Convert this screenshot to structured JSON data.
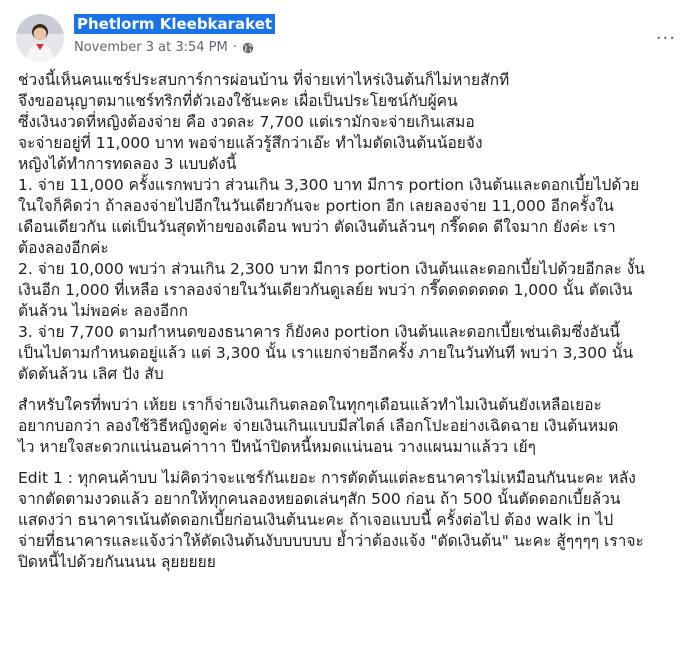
{
  "post": {
    "author": "Phetlorm Kleebkaraket",
    "timestamp": "November 3 at 3:54 PM",
    "separator": "·",
    "privacy_icon": "globe-icon",
    "more_icon": "more-options-icon",
    "more_label": "···"
  },
  "body": {
    "p1": [
      "ช่วงนี้เห็นคนแชร์ประสบการ์การผ่อนบ้าน ที่จ่ายเท่าไหร่เงินต้นก็ไม่หายสักที",
      "จึงขออนุญาตมาแชร์ทริกที่ตัวเองใช้นะคะ เผื่อเป็นประโยชน์กับผู้คน",
      "ซึ่งเงินงวดที่หญิงต้องจ่าย คือ งวดละ 7,700 แต่เรามักจะจ่ายเกินเสมอ",
      "จะจ่ายอยู่ที่ 11,000 บาท พอจ่ายแล้วรู้สึกว่าเอ๊ะ ทำไมตัดเงินต้นน้อยจัง",
      "หญิงได้ทำการทดลอง 3 แบบดังนี้",
      "1. จ่าย 11,000 ครั้งแรกพบว่า ส่วนเกิน 3,300 บาท มีการ portion เงินต้นและดอกเบี้ยไปด้วย",
      "ในใจก็คิดว่า ถ้าลองจ่ายไปอีกในวันเดียวกันจะ portion อีก เลยลองจ่าย 11,000 อีกครั้งใน",
      "เดือนเดียวกัน แต่เป็นวันสุดท้ายของเดือน พบว่า ตัดเงินต้นล้วนๆ กรี๊ดดด ดีใจมาก ยังค่ะ เรา",
      "ต้องลองอีกค่ะ",
      "2. จ่าย 10,000 พบว่า ส่วนเกิน 2,300 บาท มีการ portion เงินต้นและดอกเบี้ยไปด้วยอีกละ งั้น",
      "เงินอีก 1,000 ที่เหลือ เราลองจ่ายในวันเดียวกันดูเลย์ย พบว่า กรี๊ดดดดดดด 1,000 นั้น ตัดเงิน",
      "ต้นล้วน ไม่พอค่ะ ลองอีกก",
      "3. จ่าย 7,700 ตามกำหนดของธนาคาร ก็ยังคง portion เงินต้นและดอกเบี้ยเช่นเดิมซึ่งอันนี้",
      "เป็นไปตามกำหนดอยู่แล้ว แต่ 3,300 นั้น เราแยกจ่ายอีกครั้ง ภายในวันทันที พบว่า 3,300 นั้น",
      "ตัดต้นล้วน เลิศ ปัง สับ"
    ],
    "p2": [
      "สำหรับใครที่พบว่า เห้ยย เราก็จ่ายเงินเกินตลอดในทุกๆเดือนแล้วทำไมเงินต้นยังเหลือเยอะ",
      "อยากบอกว่า ลองใช้วิธีหญิงดูค่ะ จ่ายเงินเกินแบบมีสไตล์ เลือกโปะอย่างเฉิดฉาย เงินต้นหมด",
      "ไว หายใจสะดวกแน่นอนค่าาาา ปีหน้าปิดหนี้หมดแน่นอน วางแผนมาแล้วว เย้ๆ"
    ],
    "p3": [
      "Edit 1 : ทุกคนค้าบบ ไม่คิดว่าจะแชร์กันเยอะ การตัดต้นแต่ละธนาคารไม่เหมือนกันนะคะ หลัง",
      "จากตัดตามงวดแล้ว อยากให้ทุกคนลองหยอดเล่นๆสัก 500 ก่อน ถ้า 500 นั้นตัดดอกเบี้ยล้วน",
      "แสดงว่า ธนาคารเน้นตัดดอกเบี้ยก่อนเงินต้นนะคะ ถ้าเจอแบบนี้ ครั้งต่อไป ต้อง walk in ไป",
      "จ่ายที่ธนาคารและแจ้งว่าให้ตัดเงินต้นงับบบบบบ ย้ำว่าต้องแจ้ง \"ตัดเงินต้น\" นะคะ สู้ๆๆๆๆ เราจะ",
      "ปิดหนี้ไปด้วยกันนนน ลุยยยยย"
    ]
  }
}
